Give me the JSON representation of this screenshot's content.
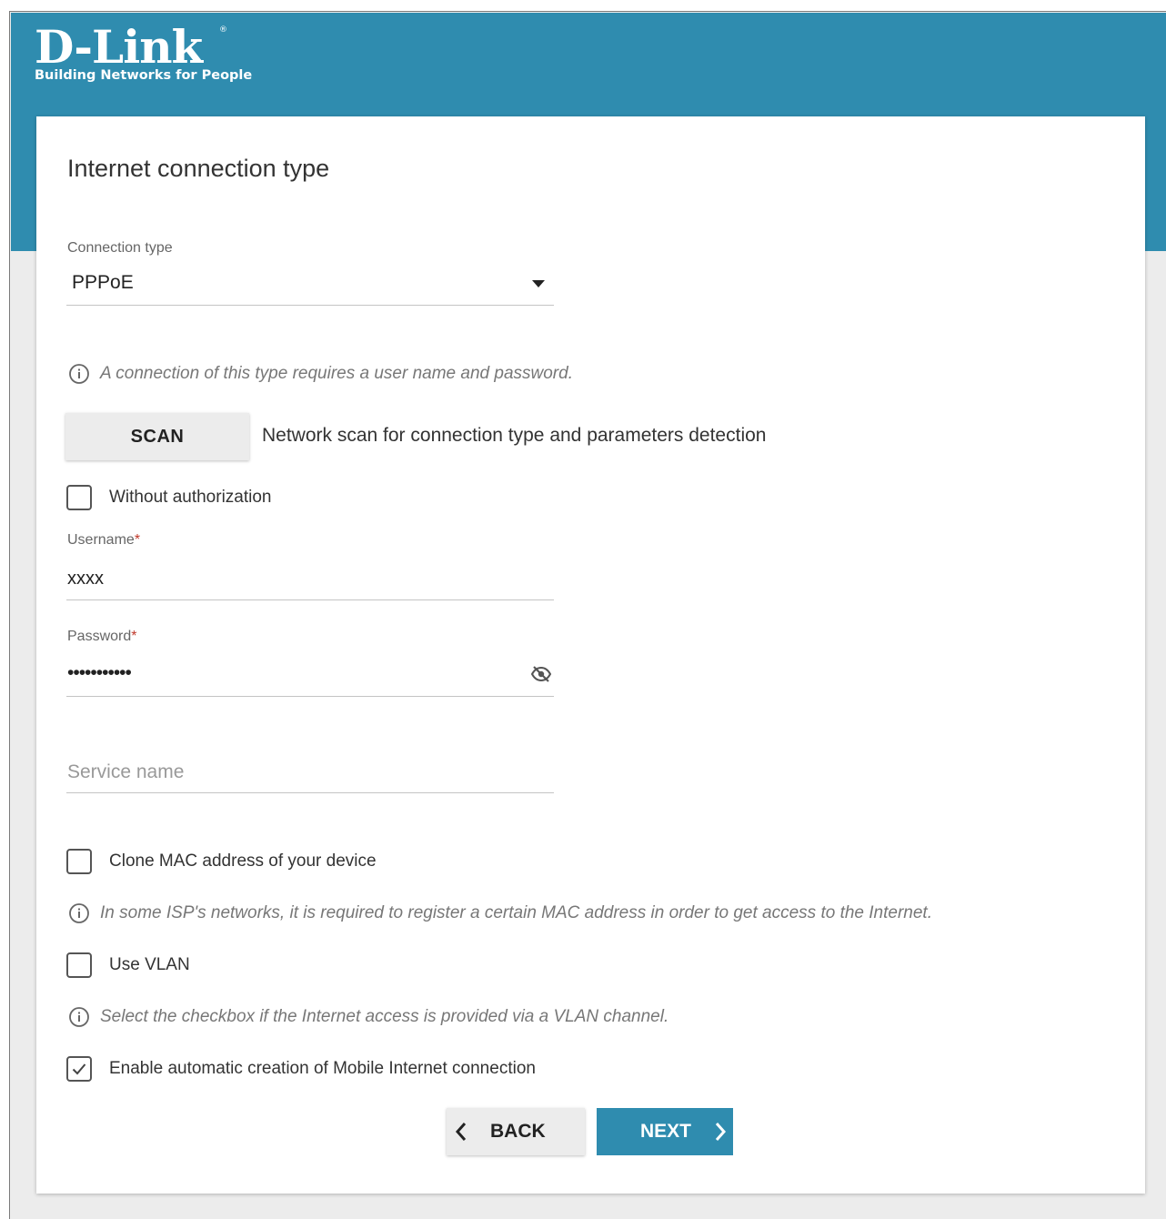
{
  "brand": {
    "name": "D-Link",
    "registered": "®",
    "tagline": "Building Networks for People"
  },
  "page": {
    "title": "Internet connection type"
  },
  "connection_type": {
    "label": "Connection type",
    "value": "PPPoE"
  },
  "connection_info": "A connection of this type requires a user name and password.",
  "scan": {
    "label": "SCAN",
    "description": "Network scan for connection type and parameters detection"
  },
  "without_authorization": {
    "label": "Without authorization",
    "checked": false
  },
  "username": {
    "label": "Username",
    "required_mark": "*",
    "value": "xxxx"
  },
  "password": {
    "label": "Password",
    "required_mark": "*",
    "value": "•••••••••••",
    "toggle_icon": "eye-off-icon"
  },
  "service_name": {
    "placeholder": "Service name",
    "value": ""
  },
  "clone_mac": {
    "label": "Clone MAC address of your device",
    "checked": false,
    "info": "In some ISP's networks, it is required to register a certain MAC address in order to get access to the Internet."
  },
  "use_vlan": {
    "label": "Use VLAN",
    "checked": false,
    "info": "Select the checkbox if the Internet access is provided via a VLAN channel."
  },
  "mobile_internet": {
    "label": "Enable automatic creation of Mobile Internet connection",
    "checked": true
  },
  "buttons": {
    "back": "BACK",
    "next": "NEXT"
  },
  "colors": {
    "brand_blue": "#2f8caf",
    "required_red": "#c0392b"
  }
}
